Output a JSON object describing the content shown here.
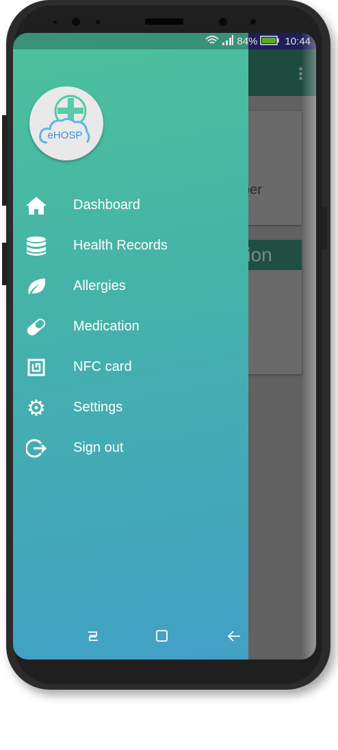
{
  "status_bar": {
    "battery": "84%",
    "time": "10:44"
  },
  "background": {
    "card_text": "ber",
    "card_header": "ation"
  },
  "logo": {
    "text": "eHOSP"
  },
  "menu": [
    {
      "label": "Dashboard",
      "icon": "home-icon"
    },
    {
      "label": "Health Records",
      "icon": "database-icon"
    },
    {
      "label": "Allergies",
      "icon": "leaf-icon"
    },
    {
      "label": "Medication",
      "icon": "pill-icon"
    },
    {
      "label": "NFC card",
      "icon": "nfc-icon"
    },
    {
      "label": "Settings",
      "icon": "gear-icon"
    },
    {
      "label": "Sign out",
      "icon": "sign-out-icon"
    }
  ],
  "colors": {
    "drawer_top": "#4cc29a",
    "drawer_bottom": "#42a0c6",
    "appbar": "#1e4a3e"
  }
}
